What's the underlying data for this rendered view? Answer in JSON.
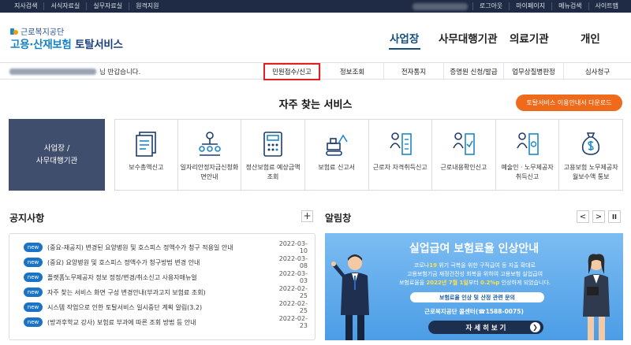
{
  "topbar": {
    "left_links": [
      "지사검색",
      "서식자료실",
      "실무자료실",
      "원격지원"
    ],
    "right_links": [
      "로그아웃",
      "마이페이지",
      "메뉴검색",
      "사이트맵"
    ]
  },
  "brand": {
    "org": "근로복지공단",
    "service_blue": "고용·산재보험",
    "service_dark": "토탈서비스",
    "colors": {
      "navy": "#1a3f7a",
      "blue": "#1783c7",
      "orange": "#ef6a1b"
    }
  },
  "main_nav": [
    "사업장",
    "사무대행기관",
    "의료기관",
    "개인"
  ],
  "welcome_suffix": "님 반갑습니다.",
  "sub_nav": [
    "민원접수/신고",
    "정보조회",
    "전자통지",
    "증명원 신청/발급",
    "업무상질병판정",
    "심사청구"
  ],
  "services": {
    "title": "자주 찾는 서비스",
    "download_button": "토탈서비스 이용안내서 다운로드",
    "side_panel": [
      "사업장 /",
      "사무대행기관"
    ],
    "items": [
      {
        "label": "보수총액신고",
        "icon": "document-list-icon"
      },
      {
        "label": "일자리안정자금신청화면안내",
        "icon": "org-chart-icon"
      },
      {
        "label": "정산보험료 예상금액 조회",
        "icon": "calculator-icon"
      },
      {
        "label": "보험료 신고서",
        "icon": "excavator-icon"
      },
      {
        "label": "근로자 자격취득신고",
        "icon": "worker-register-icon"
      },
      {
        "label": "근로내용확인신고",
        "icon": "worker-confirm-icon"
      },
      {
        "label": "예술인ㆍ노무제공자 취득신고",
        "icon": "artist-register-icon"
      },
      {
        "label": "고용보험 노무제공자 월보수액 통보",
        "icon": "money-bag-icon"
      }
    ]
  },
  "notice": {
    "title": "공지사항",
    "plus": "+",
    "badge": "new",
    "items": [
      {
        "text": "(중요-재공지) 변경된 요양병원 및 호스피스 정액수가 청구 적용일 안내",
        "date": "2022-03-10"
      },
      {
        "text": "(중요) 요양병원 및 호스피스 정액수가 청구방법 변경 안내",
        "date": "2022-03-08"
      },
      {
        "text": "플랫폼노무제공자 정보 정정/변경/취소신고 사용자매뉴얼",
        "date": "2022-03-03"
      },
      {
        "text": "자주 찾는 서비스 화면 구성 변경안내(부과고지 보험료 조회)",
        "date": "2022-02-25"
      },
      {
        "text": "시스템 작업으로 인한 토탈서비스 일시중단 계획 알림(3.2)",
        "date": "2022-02-25"
      },
      {
        "text": "(방과후학교 강사) 보험료 부과에 따른 조회 방법 등 안내",
        "date": "2022-02-23"
      }
    ]
  },
  "alarm": {
    "title": "알림창",
    "prev": "<",
    "next": ">",
    "pause": "II",
    "banner_title": "실업급여 보험료율 인상안내",
    "line1_a": "코로나",
    "line1_b": "19",
    "line1_c": " 위기 극복을 위한 구직급여 등 지출 확대로",
    "line2": "고용보험기금 재정건전성 회복을 위하여 고용보험 실업급여",
    "line3_a": "보험료율을 ",
    "line3_b": "2022년 7월 1일",
    "line3_c": "부터 ",
    "line3_d": "0.2%p",
    "line3_e": " 인상하게 되었습니다.",
    "pill": "보험료율 인상 및 산정 관련 문의",
    "contact": "근로복지공단 콜센터(☎1588-0075)",
    "button": "자 세 히 보 기",
    "button_arrow": "❯"
  }
}
